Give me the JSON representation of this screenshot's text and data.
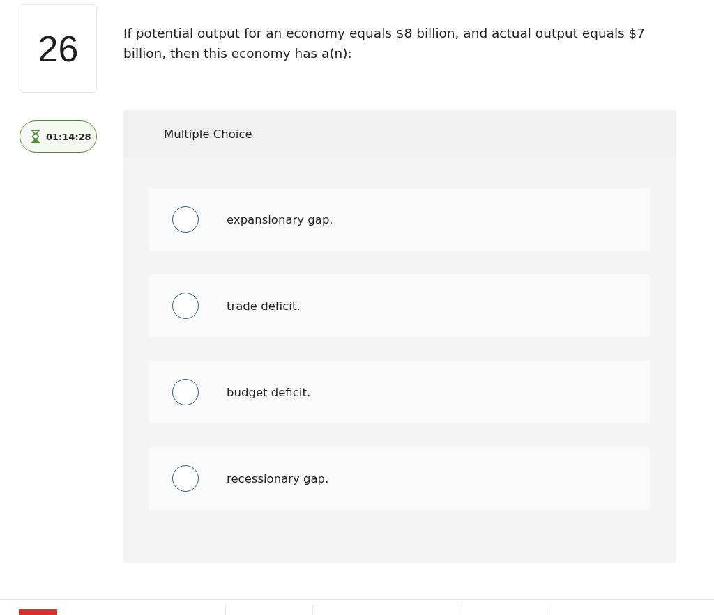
{
  "question": {
    "number": "26",
    "text": "If potential output for an economy equals $8 billion, and actual output equals $7 billion, then this economy has a(n):"
  },
  "timer": {
    "time": "01:14:28"
  },
  "answer_panel": {
    "title": "Multiple Choice",
    "options": [
      {
        "label": "expansionary gap.",
        "selected": false
      },
      {
        "label": "trade deficit.",
        "selected": false
      },
      {
        "label": "budget deficit.",
        "selected": false
      },
      {
        "label": "recessionary gap.",
        "selected": false
      }
    ]
  }
}
